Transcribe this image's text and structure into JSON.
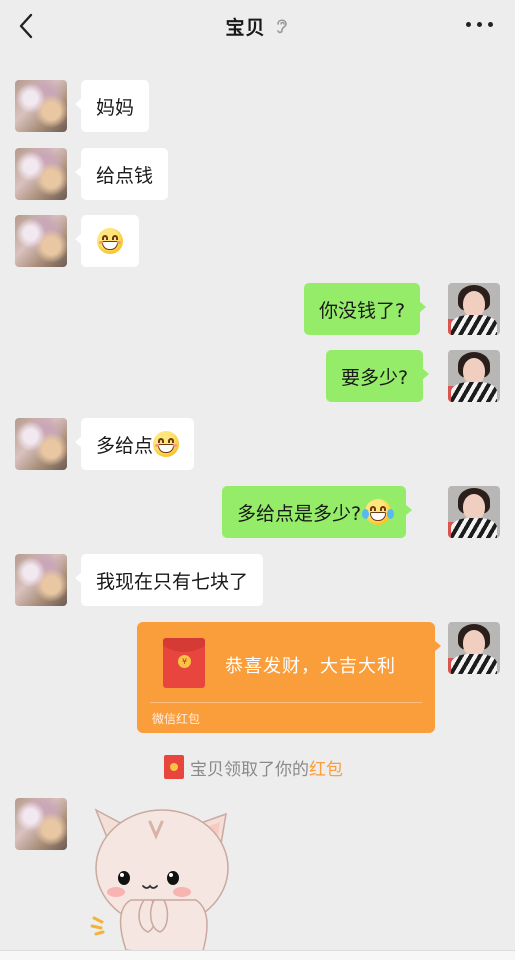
{
  "header": {
    "title": "宝贝",
    "back_icon": "chevron-left-icon",
    "status_icon": "ear-icon",
    "menu_icon": "more-icon"
  },
  "messages": [
    {
      "side": "left",
      "type": "text",
      "text": "妈妈"
    },
    {
      "side": "left",
      "type": "text",
      "text": "给点钱"
    },
    {
      "side": "left",
      "type": "emoji",
      "emoji": "grin-emoji"
    },
    {
      "side": "right",
      "type": "text",
      "text": "你没钱了?"
    },
    {
      "side": "right",
      "type": "text",
      "text": "要多少?"
    },
    {
      "side": "left",
      "type": "text_emoji",
      "text": "多给点",
      "emoji": "grin-emoji"
    },
    {
      "side": "right",
      "type": "text_emoji",
      "text": "多给点是多少?",
      "emoji": "laugh-cry-emoji"
    },
    {
      "side": "left",
      "type": "text",
      "text": "我现在只有七块了"
    },
    {
      "side": "right",
      "type": "red_packet",
      "title": "恭喜发财，大吉大利",
      "footer": "微信红包",
      "coin_symbol": "¥"
    },
    {
      "type": "system",
      "text": "宝贝领取了你的",
      "link": "红包"
    },
    {
      "side": "left",
      "type": "sticker",
      "sticker": "cat-sticker"
    }
  ],
  "colors": {
    "background": "#ededed",
    "sent_bubble": "#95ec69",
    "received_bubble": "#ffffff",
    "red_packet": "#fa9d3b",
    "red_packet_icon": "#e9453f"
  }
}
